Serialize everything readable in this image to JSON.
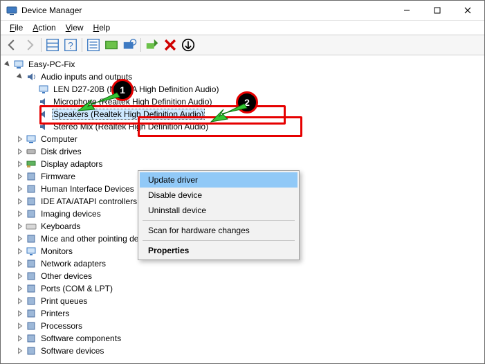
{
  "titlebar": {
    "title": "Device Manager"
  },
  "menu": {
    "file": "File",
    "action": "Action",
    "view": "View",
    "help": "Help"
  },
  "tree": {
    "root": "Easy-PC-Fix",
    "audio_cat": "Audio inputs and outputs",
    "audio_items": [
      "LEN D27-20B (NVIDIA High Definition Audio)",
      "Microphone (Realtek High Definition Audio)",
      "Speakers (Realtek High Definition Audio)",
      "Stereo Mix (Realtek High Definition Audio)"
    ],
    "cats": [
      "Computer",
      "Disk drives",
      "Display adaptors",
      "Firmware",
      "Human Interface Devices",
      "IDE ATA/ATAPI controllers",
      "Imaging devices",
      "Keyboards",
      "Mice and other pointing devices",
      "Monitors",
      "Network adapters",
      "Other devices",
      "Ports (COM & LPT)",
      "Print queues",
      "Printers",
      "Processors",
      "Software components",
      "Software devices"
    ]
  },
  "context_menu": {
    "update": "Update driver",
    "disable": "Disable device",
    "uninstall": "Uninstall device",
    "scan": "Scan for hardware changes",
    "properties": "Properties"
  },
  "annotations": {
    "badge1": "1",
    "badge2": "2"
  }
}
